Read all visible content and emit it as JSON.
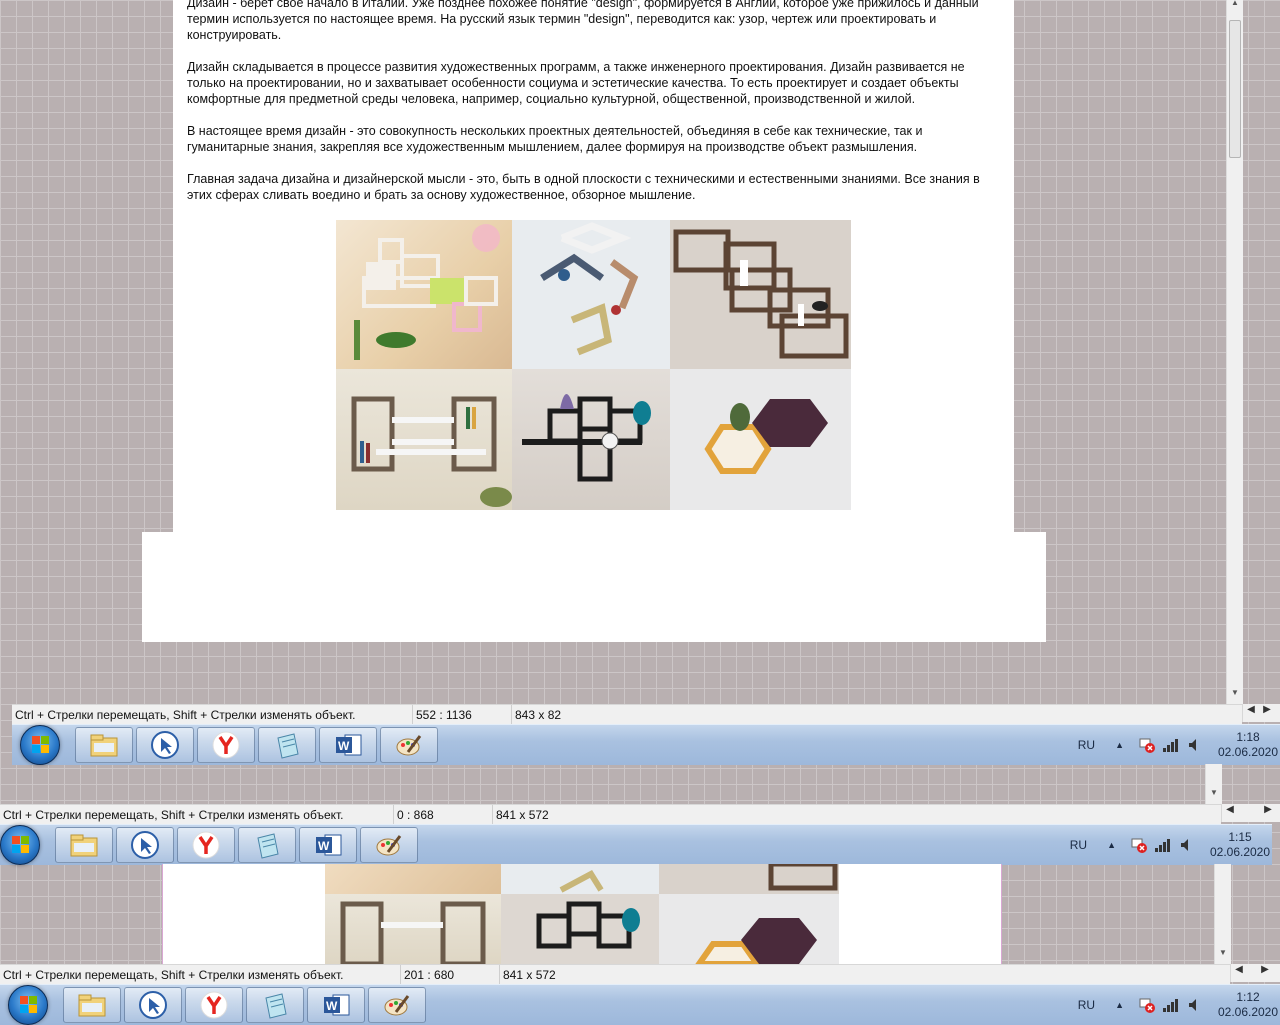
{
  "document": {
    "paragraphs": [
      "Дизайн - берет свое начало в Италии. Уже позднее похожее понятие \"design\", формируется в Англии, которое уже прижилось и данный термин используется по настоящее время. На русский язык термин \"design\", переводится как: узор, чертеж или проектировать и конструировать.",
      "Дизайн складывается в процессе развития художественных программ, а также инженерного проектирования. Дизайн развивается не только на проектировании, но и захватывает особенности социума и эстетические качества. То есть проектирует и создает объекты комфортные для предметной среды человека, например, социально культурной, общественной, производственной и жилой.",
      "В настоящее время дизайн - это совокупность нескольких проектных деятельностей, объединяя в себе как технические, так и гуманитарные знания, закрепляя все художественным мышлением, далее формируя на производстве объект размышления.",
      "Главная задача дизайна и дизайнерской мысли - это, быть в одной плоскости с техническими и естественными знаниями. Все знания в этих сферах сливать воедино и брать за основу художественное, обзорное мышление."
    ]
  },
  "windows": [
    {
      "status_hint": "Ctrl + Стрелки перемещать, Shift + Стрелки изменять объект.",
      "status_position": "552 : 1136",
      "status_size": "843 x 82",
      "tray_lang": "RU",
      "clock_time": "1:18",
      "clock_date": "02.06.2020"
    },
    {
      "status_hint": "Ctrl + Стрелки перемещать, Shift + Стрелки изменять объект.",
      "status_position": "0 : 868",
      "status_size": "841 x 572",
      "tray_lang": "RU",
      "clock_time": "1:15",
      "clock_date": "02.06.2020"
    },
    {
      "status_hint": "Ctrl + Стрелки перемещать, Shift + Стрелки изменять объект.",
      "status_position": "201 : 680",
      "status_size": "841 x 572",
      "tray_lang": "RU",
      "clock_time": "1:12",
      "clock_date": "02.06.2020"
    }
  ],
  "taskbar_apps": [
    "explorer-icon",
    "cursor-tool-icon",
    "yandex-browser-icon",
    "notepad-icon",
    "word-icon",
    "paint-icon"
  ],
  "colors": {
    "canvas_bg": "#b9b0b1",
    "taskbar": "#a9c1e0",
    "word_blue": "#2b579a",
    "yandex_red": "#e52620"
  }
}
